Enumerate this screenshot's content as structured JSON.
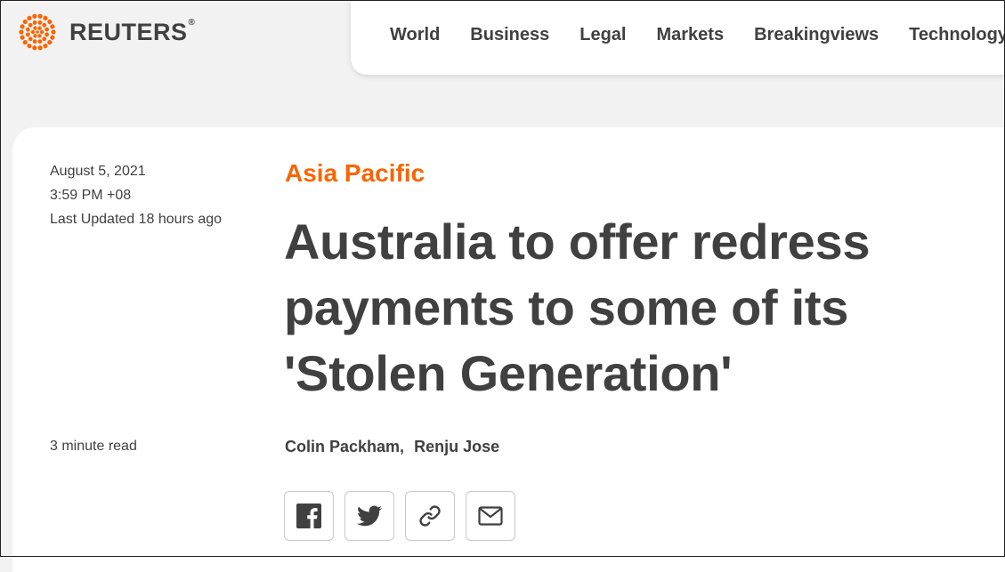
{
  "brand": {
    "name": "REUTERS",
    "registered": "®",
    "accent_color": "#fa6400"
  },
  "nav": {
    "items": [
      "World",
      "Business",
      "Legal",
      "Markets",
      "Breakingviews",
      "Technology"
    ]
  },
  "article": {
    "date": "August 5, 2021",
    "time": "3:59 PM +08",
    "last_updated": "Last Updated 18 hours ago",
    "read_time": "3 minute read",
    "section": "Asia Pacific",
    "headline": "Australia to offer redress payments to some of its 'Stolen Generation'",
    "authors": [
      "Colin Packham",
      "Renju Jose"
    ],
    "author_separator": ","
  },
  "share": {
    "buttons": [
      {
        "icon": "facebook-icon"
      },
      {
        "icon": "twitter-icon"
      },
      {
        "icon": "link-icon"
      },
      {
        "icon": "email-icon"
      }
    ]
  }
}
